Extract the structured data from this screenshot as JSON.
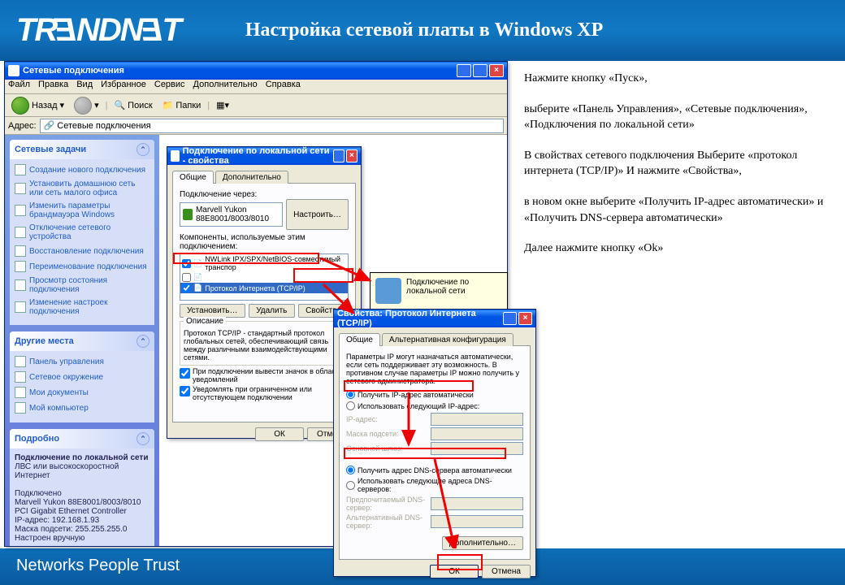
{
  "brand": {
    "logo": "TRENDNET",
    "footer": "Networks People Trust"
  },
  "page_title": "Настройка сетевой  платы  в Windows XP",
  "instructions": {
    "p1": "Нажмите кнопку «Пуск»,",
    "p2": "выберите «Панель Управления», «Сетевые подключения», «Подключения по локальной сети»",
    "p3": "В свойствах сетевого подключения Выберите «протокол интернета (TCP/IP)» И нажмите «Свойства»,",
    "p4": "в новом окне выберите «Получить IP-адрес автоматически» и «Получить DNS-сервера автоматически»",
    "p5": "Далее нажмите кнопку «Ok»"
  },
  "explorer": {
    "title": "Сетевые подключения",
    "menu": [
      "Файл",
      "Правка",
      "Вид",
      "Избранное",
      "Сервис",
      "Дополнительно",
      "Справка"
    ],
    "toolbar": {
      "back": "Назад",
      "search": "Поиск",
      "folders": "Папки"
    },
    "address_label": "Адрес:",
    "address_value": "Сетевые подключения"
  },
  "sidebar": {
    "tasks": {
      "title": "Сетевые задачи",
      "items": [
        "Создание нового подключения",
        "Установить домашнюю сеть или сеть малого офиса",
        "Изменить параметры брандмауэра Windows",
        "Отключение сетевого устройства",
        "Восстановление подключения",
        "Переименование подключения",
        "Просмотр состояния подключения",
        "Изменение настроек подключения"
      ]
    },
    "places": {
      "title": "Другие места",
      "items": [
        "Панель управления",
        "Сетевое окружение",
        "Мои документы",
        "Мой компьютер"
      ]
    },
    "details": {
      "title": "Подробно",
      "name": "Подключение по локальной сети",
      "type": "ЛВС или высокоскоростной Интернет",
      "status": "Подключено",
      "device": "Marvell Yukon 88E8001/8003/8010 PCI Gigabit Ethernet Controller",
      "ip": "IP-адрес: 192.168.1.93",
      "mask": "Маска подсети: 255.255.255.0",
      "mode": "Настроен вручную"
    }
  },
  "dialog1": {
    "title": "Подключение по локальной сети - свойства",
    "tabs": [
      "Общие",
      "Дополнительно"
    ],
    "connect_via": "Подключение через:",
    "nic": "Marvell Yukon 88E8001/8003/8010",
    "configure": "Настроить…",
    "components_label": "Компоненты, используемые этим подключением:",
    "components": [
      "NWLink IPX/SPX/NetBIOS-совместимый транспор",
      "Протокол Интернета (TCP/IP)"
    ],
    "install": "Установить…",
    "uninstall": "Удалить",
    "properties": "Свойства",
    "desc_title": "Описание",
    "desc": "Протокол TCP/IP - стандартный протокол глобальных сетей, обеспечивающий связь между различными взаимодействующими сетями.",
    "chk1": "При подключении вывести значок в области уведомлений",
    "chk2": "Уведомлять при ограниченном или отсутствующем подключении",
    "ok": "ОК",
    "cancel": "Отмена"
  },
  "tooltip": "Подключение по локальной сети",
  "dialog2": {
    "title": "Свойства: Протокол Интернета (TCP/IP)",
    "tabs": [
      "Общие",
      "Альтернативная конфигурация"
    ],
    "para": "Параметры IP могут назначаться автоматически, если сеть поддерживает эту возможность. В противном случае параметры IP можно получить у сетевого администратора.",
    "r1": "Получить IP-адрес автоматически",
    "r2": "Использовать следующий IP-адрес:",
    "ip_label": "IP-адрес:",
    "mask_label": "Маска подсети:",
    "gw_label": "Основной шлюз:",
    "r3": "Получить адрес DNS-сервера автоматически",
    "r4": "Использовать следующие адреса DNS-серверов:",
    "dns1_label": "Предпочитаемый DNS-сервер:",
    "dns2_label": "Альтернативный DNS-сервер:",
    "advanced": "Дополнительно…",
    "ok": "ОК",
    "cancel": "Отмена"
  }
}
